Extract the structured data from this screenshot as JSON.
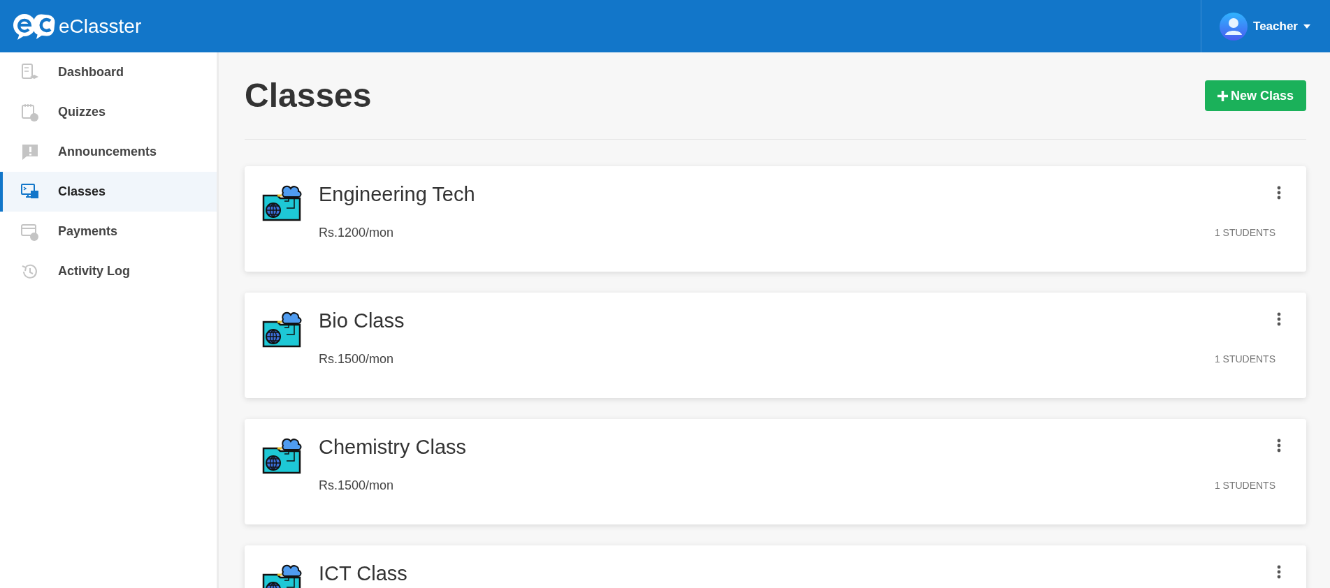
{
  "header": {
    "brand": "eClasster",
    "user": {
      "name": "Teacher"
    }
  },
  "sidebar": {
    "items": [
      {
        "label": "Dashboard",
        "kind": "dashboard",
        "selected": false
      },
      {
        "label": "Quizzes",
        "kind": "quiz",
        "selected": false
      },
      {
        "label": "Announcements",
        "kind": "announcement",
        "selected": false
      },
      {
        "label": "Classes",
        "kind": "classes",
        "selected": true
      },
      {
        "label": "Payments",
        "kind": "payment",
        "selected": false
      },
      {
        "label": "Activity Log",
        "kind": "history",
        "selected": false
      }
    ]
  },
  "page": {
    "title": "Classes",
    "new_button": "New Class"
  },
  "classes": [
    {
      "name": "Engineering Tech",
      "fee": "Rs.1200/mon",
      "students": "1 STUDENTS"
    },
    {
      "name": "Bio Class",
      "fee": "Rs.1500/mon",
      "students": "1 STUDENTS"
    },
    {
      "name": "Chemistry Class",
      "fee": "Rs.1500/mon",
      "students": "1 STUDENTS"
    },
    {
      "name": "ICT Class"
    }
  ]
}
